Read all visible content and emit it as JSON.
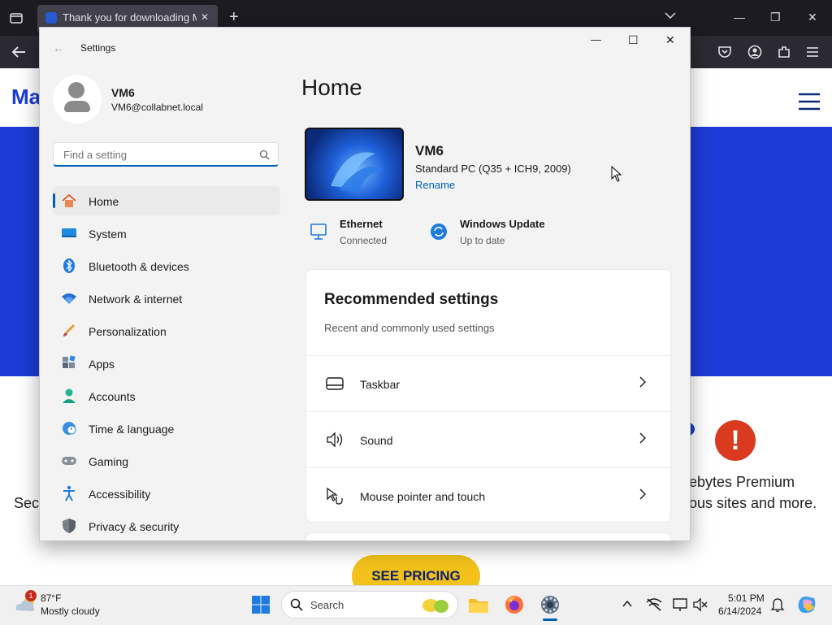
{
  "browser": {
    "tab_title": "Thank you for downloading Ma",
    "new_tab_label": "+",
    "tab_close": "✕",
    "header_logo": "Ma",
    "controls": {
      "minimize": "—",
      "restore": "❐",
      "close": "✕"
    }
  },
  "page": {
    "left_text": "Sec",
    "right_text_1": "ebytes Premium",
    "right_text_2": "ous sites and more.",
    "pricing_button": "SEE PRICING"
  },
  "settings": {
    "window_title": "Settings",
    "back_icon": "←",
    "controls": {
      "minimize": "—",
      "maximize": "☐",
      "close": "✕"
    },
    "user": {
      "name": "VM6",
      "email": "VM6@collabnet.local"
    },
    "search": {
      "placeholder": "Find a setting",
      "icon": "search-icon"
    },
    "nav": [
      {
        "label": "Home",
        "icon": "home-icon",
        "selected": true
      },
      {
        "label": "System",
        "icon": "system-icon"
      },
      {
        "label": "Bluetooth & devices",
        "icon": "bluetooth-icon"
      },
      {
        "label": "Network & internet",
        "icon": "wifi-icon"
      },
      {
        "label": "Personalization",
        "icon": "brush-icon"
      },
      {
        "label": "Apps",
        "icon": "apps-icon"
      },
      {
        "label": "Accounts",
        "icon": "accounts-icon"
      },
      {
        "label": "Time & language",
        "icon": "globe-clock-icon"
      },
      {
        "label": "Gaming",
        "icon": "gamepad-icon"
      },
      {
        "label": "Accessibility",
        "icon": "accessibility-icon"
      },
      {
        "label": "Privacy & security",
        "icon": "shield-icon"
      }
    ],
    "main": {
      "title": "Home",
      "pc": {
        "name": "VM6",
        "description": "Standard PC (Q35 + ICH9, 2009)",
        "rename": "Rename"
      },
      "status": [
        {
          "title": "Ethernet",
          "subtitle": "Connected",
          "icon": "ethernet-icon"
        },
        {
          "title": "Windows Update",
          "subtitle": "Up to date",
          "icon": "update-icon"
        }
      ],
      "recommended": {
        "title": "Recommended settings",
        "subtitle": "Recent and commonly used settings",
        "items": [
          {
            "label": "Taskbar",
            "icon": "taskbar-icon"
          },
          {
            "label": "Sound",
            "icon": "speaker-icon"
          },
          {
            "label": "Mouse pointer and touch",
            "icon": "pointer-icon"
          }
        ]
      }
    }
  },
  "taskbar": {
    "weather": {
      "temp": "87°F",
      "condition": "Mostly cloudy",
      "badge": "1"
    },
    "search_label": "Search",
    "time": "5:01 PM",
    "date": "6/14/2024",
    "tray_chevron": "^"
  },
  "colors": {
    "accent": "#005fb8",
    "hero": "#1b3cd6",
    "pricing": "#f2c21b"
  }
}
